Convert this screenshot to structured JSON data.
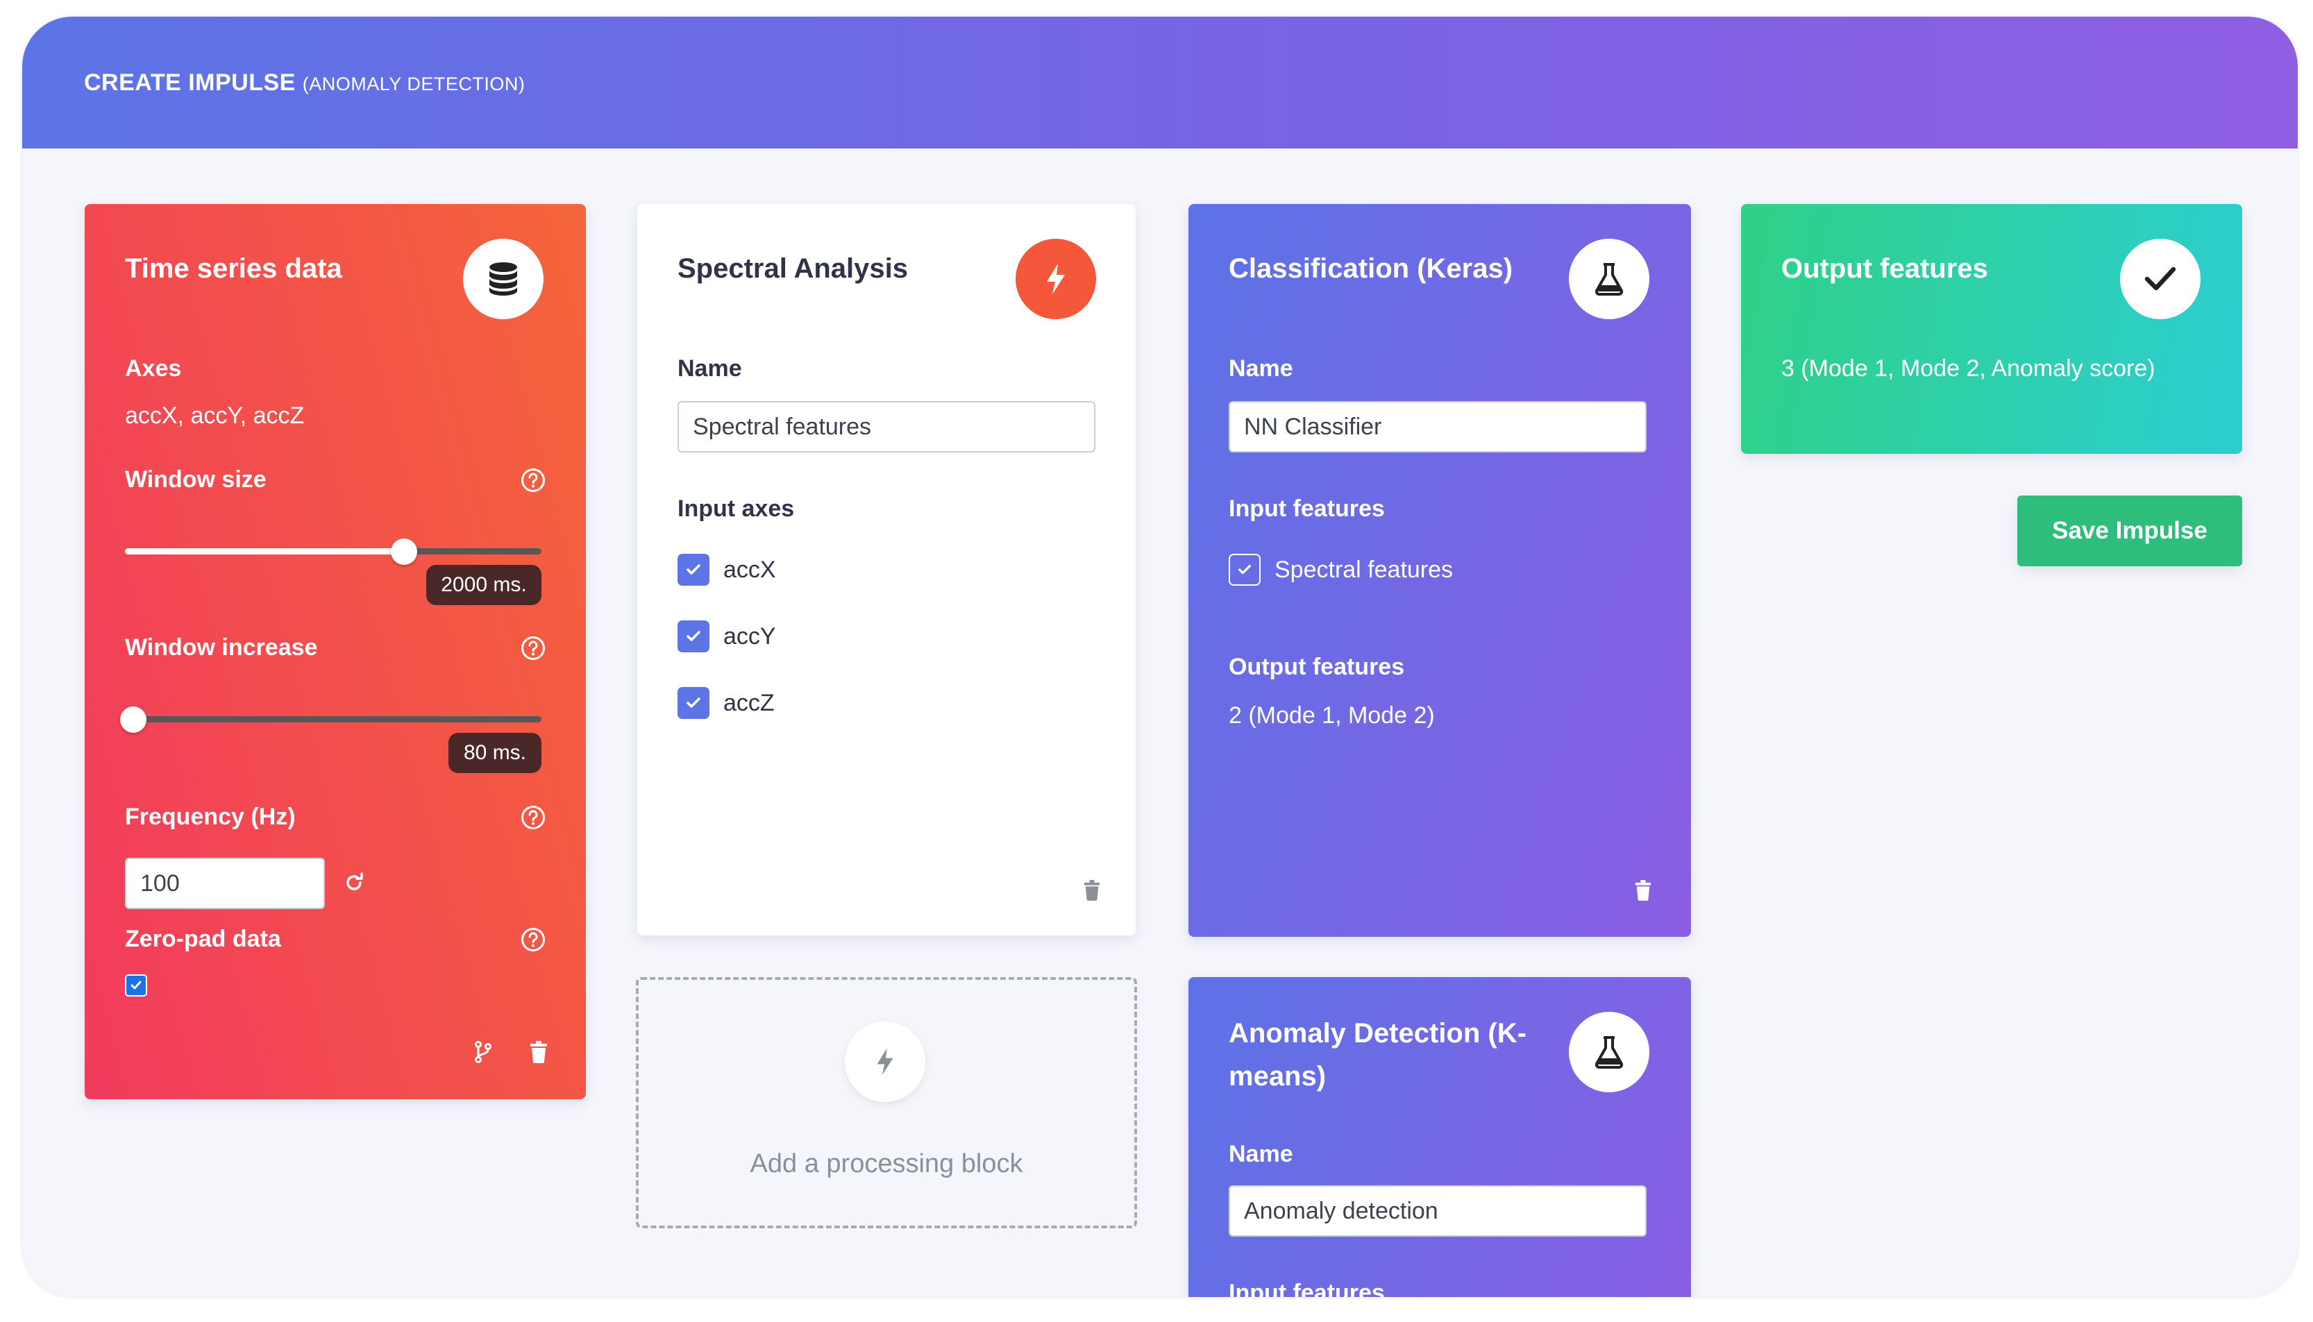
{
  "header": {
    "title": "CREATE IMPULSE",
    "subtitle": "(ANOMALY DETECTION)"
  },
  "time_series": {
    "title": "Time series data",
    "icon": "database-icon",
    "axes_label": "Axes",
    "axes_value": "accX, accY, accZ",
    "window_size_label": "Window size",
    "window_size_value": "2000 ms.",
    "window_size_fraction": 0.67,
    "window_increase_label": "Window increase",
    "window_increase_value": "80 ms.",
    "window_increase_fraction": 0.02,
    "frequency_label": "Frequency (Hz)",
    "frequency_value": "100",
    "zero_pad_label": "Zero-pad data",
    "zero_pad_checked": true
  },
  "spectral": {
    "title": "Spectral Analysis",
    "icon": "bolt-icon",
    "name_label": "Name",
    "name_value": "Spectral features",
    "input_axes_label": "Input axes",
    "axes": [
      "accX",
      "accY",
      "accZ"
    ]
  },
  "add_block": {
    "label": "Add a processing block",
    "icon": "bolt-icon"
  },
  "classification": {
    "title": "Classification (Keras)",
    "icon": "flask-icon",
    "name_label": "Name",
    "name_value": "NN Classifier",
    "input_features_label": "Input features",
    "input_feature": "Spectral features",
    "output_features_label": "Output features",
    "output_features_value": "2 (Mode 1, Mode 2)"
  },
  "anomaly": {
    "title": "Anomaly Detection (K-means)",
    "icon": "flask-icon",
    "name_label": "Name",
    "name_value": "Anomaly detection",
    "input_features_label": "Input features"
  },
  "output": {
    "title": "Output features",
    "icon": "checkmark-icon",
    "value": "3 (Mode 1, Mode 2, Anomaly score)"
  },
  "save_button": "Save Impulse",
  "colors": {
    "header_start": "#5c74e6",
    "header_end": "#8f5fe2",
    "input_block_start": "#f23a5e",
    "input_block_end": "#f4653a",
    "learn_block_start": "#5c72e6",
    "learn_block_end": "#8a5ee3",
    "output_start": "#2fd186",
    "output_end": "#2cced1",
    "save_button": "#2dbe7c",
    "accent_orange": "#f4573a",
    "checkbox_blue": "#5d74e4"
  }
}
